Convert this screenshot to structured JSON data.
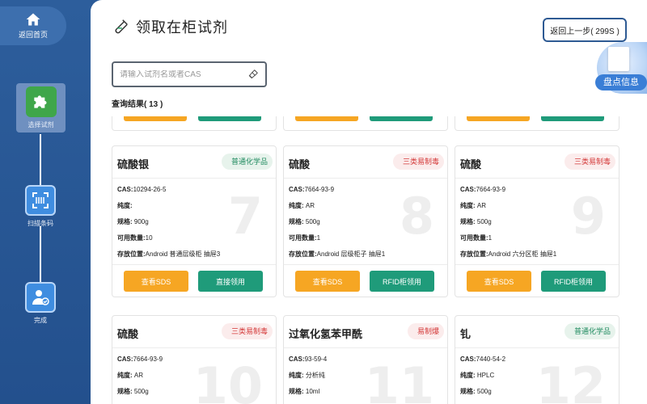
{
  "sidebar": {
    "home_label": "返回首页",
    "steps": [
      {
        "label": "选择试剂",
        "active": true
      },
      {
        "label": "扫描条码",
        "active": false
      },
      {
        "label": "完成",
        "active": false
      }
    ]
  },
  "header": {
    "title": "领取在柜试剂",
    "back_label": "返回上一步( 299S )",
    "inventory_label": "盘点信息"
  },
  "search": {
    "placeholder": "请输入试剂名或者CAS",
    "value": ""
  },
  "results": {
    "label": "查询结果( 13 )"
  },
  "cards": [
    {
      "number": "7",
      "name": "硫酸银",
      "tag": "普通化学品",
      "tag_type": "normal",
      "cas_label": "CAS:",
      "cas": "10294-26-5",
      "purity_label": "纯度:",
      "purity": "",
      "spec_label": "规格:",
      "spec": "900g",
      "qty_label": "可用数量:",
      "qty": "10",
      "loc_label": "存放位置:",
      "loc": "Android 普通层级柜 抽屉3",
      "sds_label": "查看SDS",
      "take_label": "直接领用"
    },
    {
      "number": "8",
      "name": "硫酸",
      "tag": "三类易制毒",
      "tag_type": "danger",
      "cas_label": "CAS:",
      "cas": "7664-93-9",
      "purity_label": "纯度:",
      "purity": "AR",
      "spec_label": "规格:",
      "spec": "500g",
      "qty_label": "可用数量:",
      "qty": "1",
      "loc_label": "存放位置:",
      "loc": "Android 层级柜子 抽屉1",
      "sds_label": "查看SDS",
      "take_label": "RFID柜领用"
    },
    {
      "number": "9",
      "name": "硫酸",
      "tag": "三类易制毒",
      "tag_type": "danger",
      "cas_label": "CAS:",
      "cas": "7664-93-9",
      "purity_label": "纯度:",
      "purity": "AR",
      "spec_label": "规格:",
      "spec": "500g",
      "qty_label": "可用数量:",
      "qty": "1",
      "loc_label": "存放位置:",
      "loc": "Android 六分区柜 抽屉1",
      "sds_label": "查看SDS",
      "take_label": "RFID柜领用"
    },
    {
      "number": "10",
      "name": "硫酸",
      "tag": "三类易制毒",
      "tag_type": "danger",
      "cas_label": "CAS:",
      "cas": "7664-93-9",
      "purity_label": "纯度:",
      "purity": "AR",
      "spec_label": "规格:",
      "spec": "500g"
    },
    {
      "number": "11",
      "name": "过氧化氢苯甲酰",
      "tag": "易制爆",
      "tag_type": "danger",
      "cas_label": "CAS:",
      "cas": "93-59-4",
      "purity_label": "纯度:",
      "purity": "分析纯",
      "spec_label": "规格:",
      "spec": "10ml"
    },
    {
      "number": "12",
      "name": "钆",
      "tag": "普通化学品",
      "tag_type": "normal",
      "cas_label": "CAS:",
      "cas": "7440-54-2",
      "purity_label": "纯度:",
      "purity": "HPLC",
      "spec_label": "规格:",
      "spec": "500g"
    }
  ],
  "colors": {
    "sidebar": "#2b5b98",
    "sds_button": "#f6a623",
    "take_button": "#1f9b7a",
    "tag_danger": "#d43a3a",
    "tag_normal": "#1e8a5e"
  }
}
